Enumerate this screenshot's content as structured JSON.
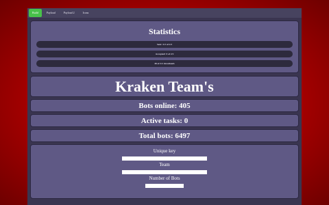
{
  "nav": {
    "items": [
      "Build",
      "Payload",
      "Payload 2",
      "Icons"
    ]
  },
  "stats": {
    "heading": "Statistics",
    "rows": [
      "Sent: 2/2 of 2/2",
      "Accepted: 0 of 2/2",
      "48 of 2/2 downloads"
    ]
  },
  "title": "Kraken Team's",
  "metrics": {
    "bots_online": "Bots online: 405",
    "active_tasks": "Active tasks: 0",
    "total_bots": "Total bots: 6497"
  },
  "form": {
    "unique_key_label": "Unique key",
    "team_label": "Team",
    "number_of_bots_label": "Number of Bots"
  },
  "colors": {
    "page_background": "#c40000",
    "panel": "#5f5985",
    "frame": "#3a3550",
    "active_tab": "#48c24a"
  }
}
